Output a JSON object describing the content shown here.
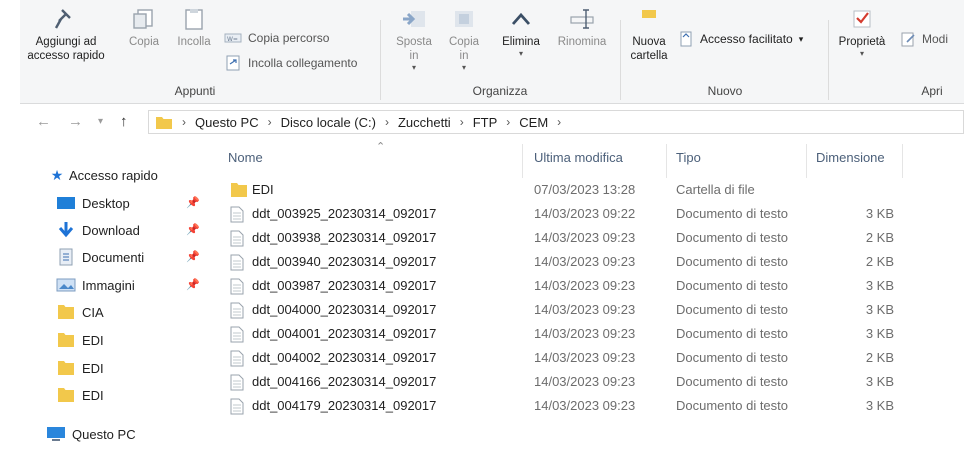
{
  "ribbon": {
    "appunti": {
      "label": "Appunti",
      "pin_quick": "Aggiungi ad\naccesso rapido",
      "copy": "Copia",
      "paste": "Incolla",
      "copy_path": "Copia percorso",
      "paste_link": "Incolla collegamento"
    },
    "organizza": {
      "label": "Organizza",
      "move": "Sposta\nin",
      "copy_to": "Copia\nin",
      "delete": "Elimina",
      "rename": "Rinomina"
    },
    "nuovo": {
      "label": "Nuovo",
      "new_folder": "Nuova\ncartella",
      "easy_access": "Accesso facilitato"
    },
    "apri": {
      "label": "Apri",
      "properties": "Proprietà",
      "edit": "Modi"
    }
  },
  "address": {
    "crumbs": [
      "Questo PC",
      "Disco locale (C:)",
      "Zucchetti",
      "FTP",
      "CEM"
    ]
  },
  "nav": {
    "quick_access": "Accesso rapido",
    "items": [
      {
        "label": "Desktop",
        "pinned": true
      },
      {
        "label": "Download",
        "pinned": true
      },
      {
        "label": "Documenti",
        "pinned": true
      },
      {
        "label": "Immagini",
        "pinned": true
      },
      {
        "label": "CIA",
        "pinned": false
      },
      {
        "label": "EDI",
        "pinned": false
      },
      {
        "label": "EDI",
        "pinned": false
      },
      {
        "label": "EDI",
        "pinned": false
      }
    ],
    "this_pc": "Questo PC"
  },
  "columns": {
    "name": "Nome",
    "modified": "Ultima modifica",
    "type": "Tipo",
    "size": "Dimensione"
  },
  "files": [
    {
      "name": "EDI",
      "modified": "07/03/2023 13:28",
      "type": "Cartella di file",
      "size": "",
      "kind": "folder"
    },
    {
      "name": "ddt_003925_20230314_092017",
      "modified": "14/03/2023 09:22",
      "type": "Documento di testo",
      "size": "3 KB",
      "kind": "txt"
    },
    {
      "name": "ddt_003938_20230314_092017",
      "modified": "14/03/2023 09:23",
      "type": "Documento di testo",
      "size": "2 KB",
      "kind": "txt"
    },
    {
      "name": "ddt_003940_20230314_092017",
      "modified": "14/03/2023 09:23",
      "type": "Documento di testo",
      "size": "2 KB",
      "kind": "txt"
    },
    {
      "name": "ddt_003987_20230314_092017",
      "modified": "14/03/2023 09:23",
      "type": "Documento di testo",
      "size": "3 KB",
      "kind": "txt"
    },
    {
      "name": "ddt_004000_20230314_092017",
      "modified": "14/03/2023 09:23",
      "type": "Documento di testo",
      "size": "3 KB",
      "kind": "txt"
    },
    {
      "name": "ddt_004001_20230314_092017",
      "modified": "14/03/2023 09:23",
      "type": "Documento di testo",
      "size": "3 KB",
      "kind": "txt"
    },
    {
      "name": "ddt_004002_20230314_092017",
      "modified": "14/03/2023 09:23",
      "type": "Documento di testo",
      "size": "2 KB",
      "kind": "txt"
    },
    {
      "name": "ddt_004166_20230314_092017",
      "modified": "14/03/2023 09:23",
      "type": "Documento di testo",
      "size": "3 KB",
      "kind": "txt"
    },
    {
      "name": "ddt_004179_20230314_092017",
      "modified": "14/03/2023 09:23",
      "type": "Documento di testo",
      "size": "3 KB",
      "kind": "txt"
    }
  ],
  "colors": {
    "folder": "#f2c84b",
    "accent": "#1e73d6",
    "header_text": "#4c607a"
  }
}
